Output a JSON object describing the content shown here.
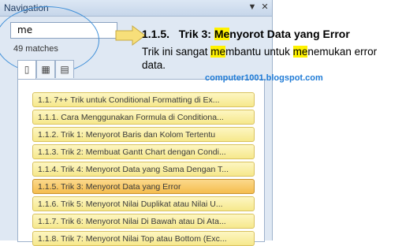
{
  "navigation": {
    "title": "Navigation",
    "dropdown_glyph": "▼",
    "close_glyph": "✕",
    "search_value": "me",
    "matches_text": "49 matches",
    "tabs": [
      {
        "icon": "browse-headings-icon",
        "glyph": "▯"
      },
      {
        "icon": "browse-pages-icon",
        "glyph": "▦"
      },
      {
        "icon": "browse-results-icon",
        "glyph": "▤"
      }
    ],
    "items": [
      {
        "label": "1.1. 7++ Trik untuk Conditional Formatting di Ex..."
      },
      {
        "label": "1.1.1. Cara Menggunakan Formula di Conditiona..."
      },
      {
        "label": "1.1.2. Trik 1: Menyorot Baris dan Kolom Tertentu"
      },
      {
        "label": "1.1.3. Trik 2: Membuat Gantt Chart dengan Condi..."
      },
      {
        "label": "1.1.4. Trik 4: Menyorot Data yang Sama Dengan T..."
      },
      {
        "label": "1.1.5. Trik 3: Menyorot Data yang Error"
      },
      {
        "label": "1.1.6. Trik 5: Menyorot Nilai Duplikat atau Nilai U..."
      },
      {
        "label": "1.1.7. Trik 6: Menyorot Nilai Di Bawah atau Di Ata..."
      },
      {
        "label": "1.1.8. Trik 7: Menyorot Nilai Top atau Bottom (Exc..."
      }
    ]
  },
  "document": {
    "heading_number": "1.1.5.",
    "heading_pre": "Trik 3: ",
    "heading_hl": "Me",
    "heading_post": "nyorot Data yang Error",
    "body_p1": "Trik ini sangat ",
    "body_hl1": "me",
    "body_p2": "mbantu untuk ",
    "body_hl2": "me",
    "body_p3": "nemukan error data.",
    "watermark": "computer1001.blogspot.com"
  },
  "colors": {
    "highlight": "#fff200",
    "arrow_fill": "#f7df7a",
    "circle": "#3f8fd8"
  }
}
